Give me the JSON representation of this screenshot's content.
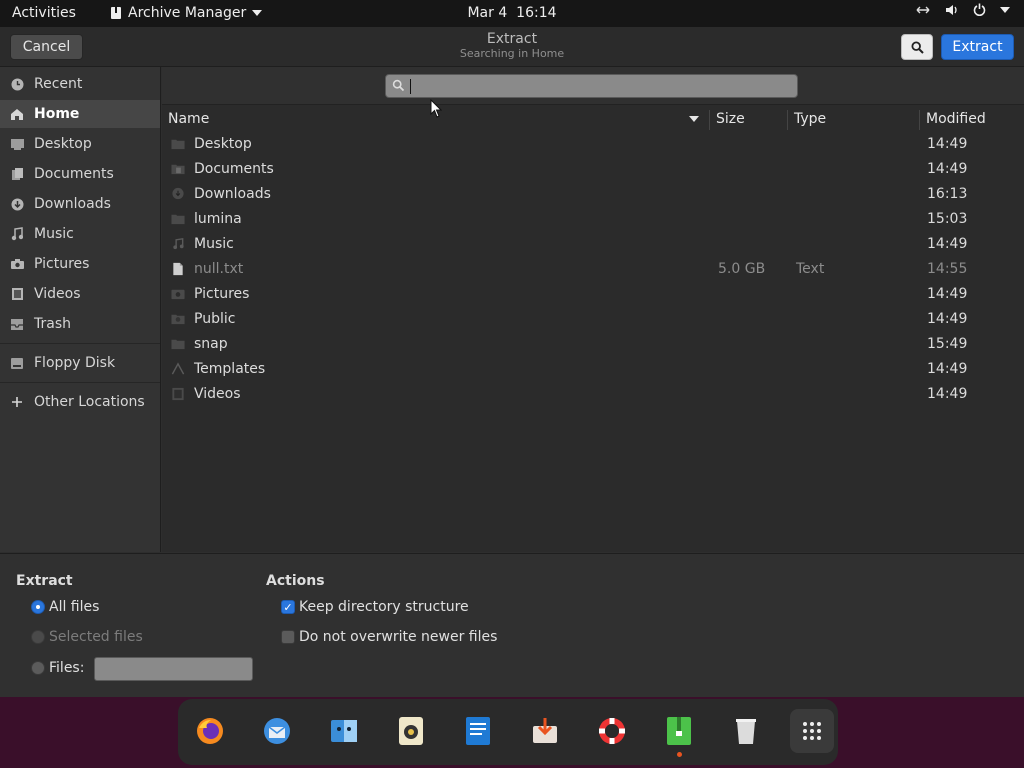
{
  "topbar": {
    "activities": "Activities",
    "app_name": "Archive Manager",
    "date": "Mar 4",
    "time": "16:14",
    "tray_icons": [
      "network-icon",
      "volume-icon",
      "power-icon",
      "chevron-down-icon"
    ]
  },
  "dialog": {
    "title": "Extract",
    "subtitle": "Searching in Home",
    "cancel_label": "Cancel",
    "extract_label": "Extract",
    "accent_color": "#2a76dd"
  },
  "sidebar": {
    "items": [
      {
        "label": "Recent",
        "icon": "clock-icon"
      },
      {
        "label": "Home",
        "icon": "home-icon",
        "active": true
      },
      {
        "label": "Desktop",
        "icon": "desktop-icon"
      },
      {
        "label": "Documents",
        "icon": "documents-icon"
      },
      {
        "label": "Downloads",
        "icon": "downloads-icon"
      },
      {
        "label": "Music",
        "icon": "music-icon"
      },
      {
        "label": "Pictures",
        "icon": "camera-icon"
      },
      {
        "label": "Videos",
        "icon": "film-icon"
      },
      {
        "label": "Trash",
        "icon": "trash-icon"
      },
      {
        "label": "Floppy Disk",
        "icon": "drive-icon"
      },
      {
        "label": "Other Locations",
        "icon": "plus-icon"
      }
    ]
  },
  "search": {
    "value": "",
    "placeholder": ""
  },
  "columns": {
    "name": "Name",
    "size": "Size",
    "type": "Type",
    "modified": "Modified"
  },
  "files": [
    {
      "name": "Desktop",
      "size": "",
      "type": "",
      "modified": "14:49",
      "icon": "folder-icon"
    },
    {
      "name": "Documents",
      "size": "",
      "type": "",
      "modified": "14:49",
      "icon": "folder-documents-icon"
    },
    {
      "name": "Downloads",
      "size": "",
      "type": "",
      "modified": "16:13",
      "icon": "folder-downloads-icon"
    },
    {
      "name": "lumina",
      "size": "",
      "type": "",
      "modified": "15:03",
      "icon": "folder-icon"
    },
    {
      "name": "Music",
      "size": "",
      "type": "",
      "modified": "14:49",
      "icon": "folder-music-icon"
    },
    {
      "name": "null.txt",
      "size": "5.0 GB",
      "type": "Text",
      "modified": "14:55",
      "icon": "text-file-icon"
    },
    {
      "name": "Pictures",
      "size": "",
      "type": "",
      "modified": "14:49",
      "icon": "folder-pictures-icon"
    },
    {
      "name": "Public",
      "size": "",
      "type": "",
      "modified": "14:49",
      "icon": "folder-public-icon"
    },
    {
      "name": "snap",
      "size": "",
      "type": "",
      "modified": "15:49",
      "icon": "folder-icon"
    },
    {
      "name": "Templates",
      "size": "",
      "type": "",
      "modified": "14:49",
      "icon": "folder-templates-icon"
    },
    {
      "name": "Videos",
      "size": "",
      "type": "",
      "modified": "14:49",
      "icon": "folder-videos-icon"
    }
  ],
  "options": {
    "extract_heading": "Extract",
    "all_files": "All files",
    "selected_files": "Selected files",
    "files_label": "Files:",
    "files_value": "",
    "actions_heading": "Actions",
    "keep_structure": "Keep directory structure",
    "no_overwrite": "Do not overwrite newer files",
    "selected_radio": "all_files",
    "keep_structure_checked": true,
    "no_overwrite_checked": false
  },
  "dock": {
    "apps": [
      "firefox-icon",
      "thunderbird-icon",
      "files-icon",
      "rhythmbox-icon",
      "writer-icon",
      "software-icon",
      "help-icon",
      "archive-manager-icon",
      "trash-icon",
      "app-grid-icon"
    ]
  }
}
